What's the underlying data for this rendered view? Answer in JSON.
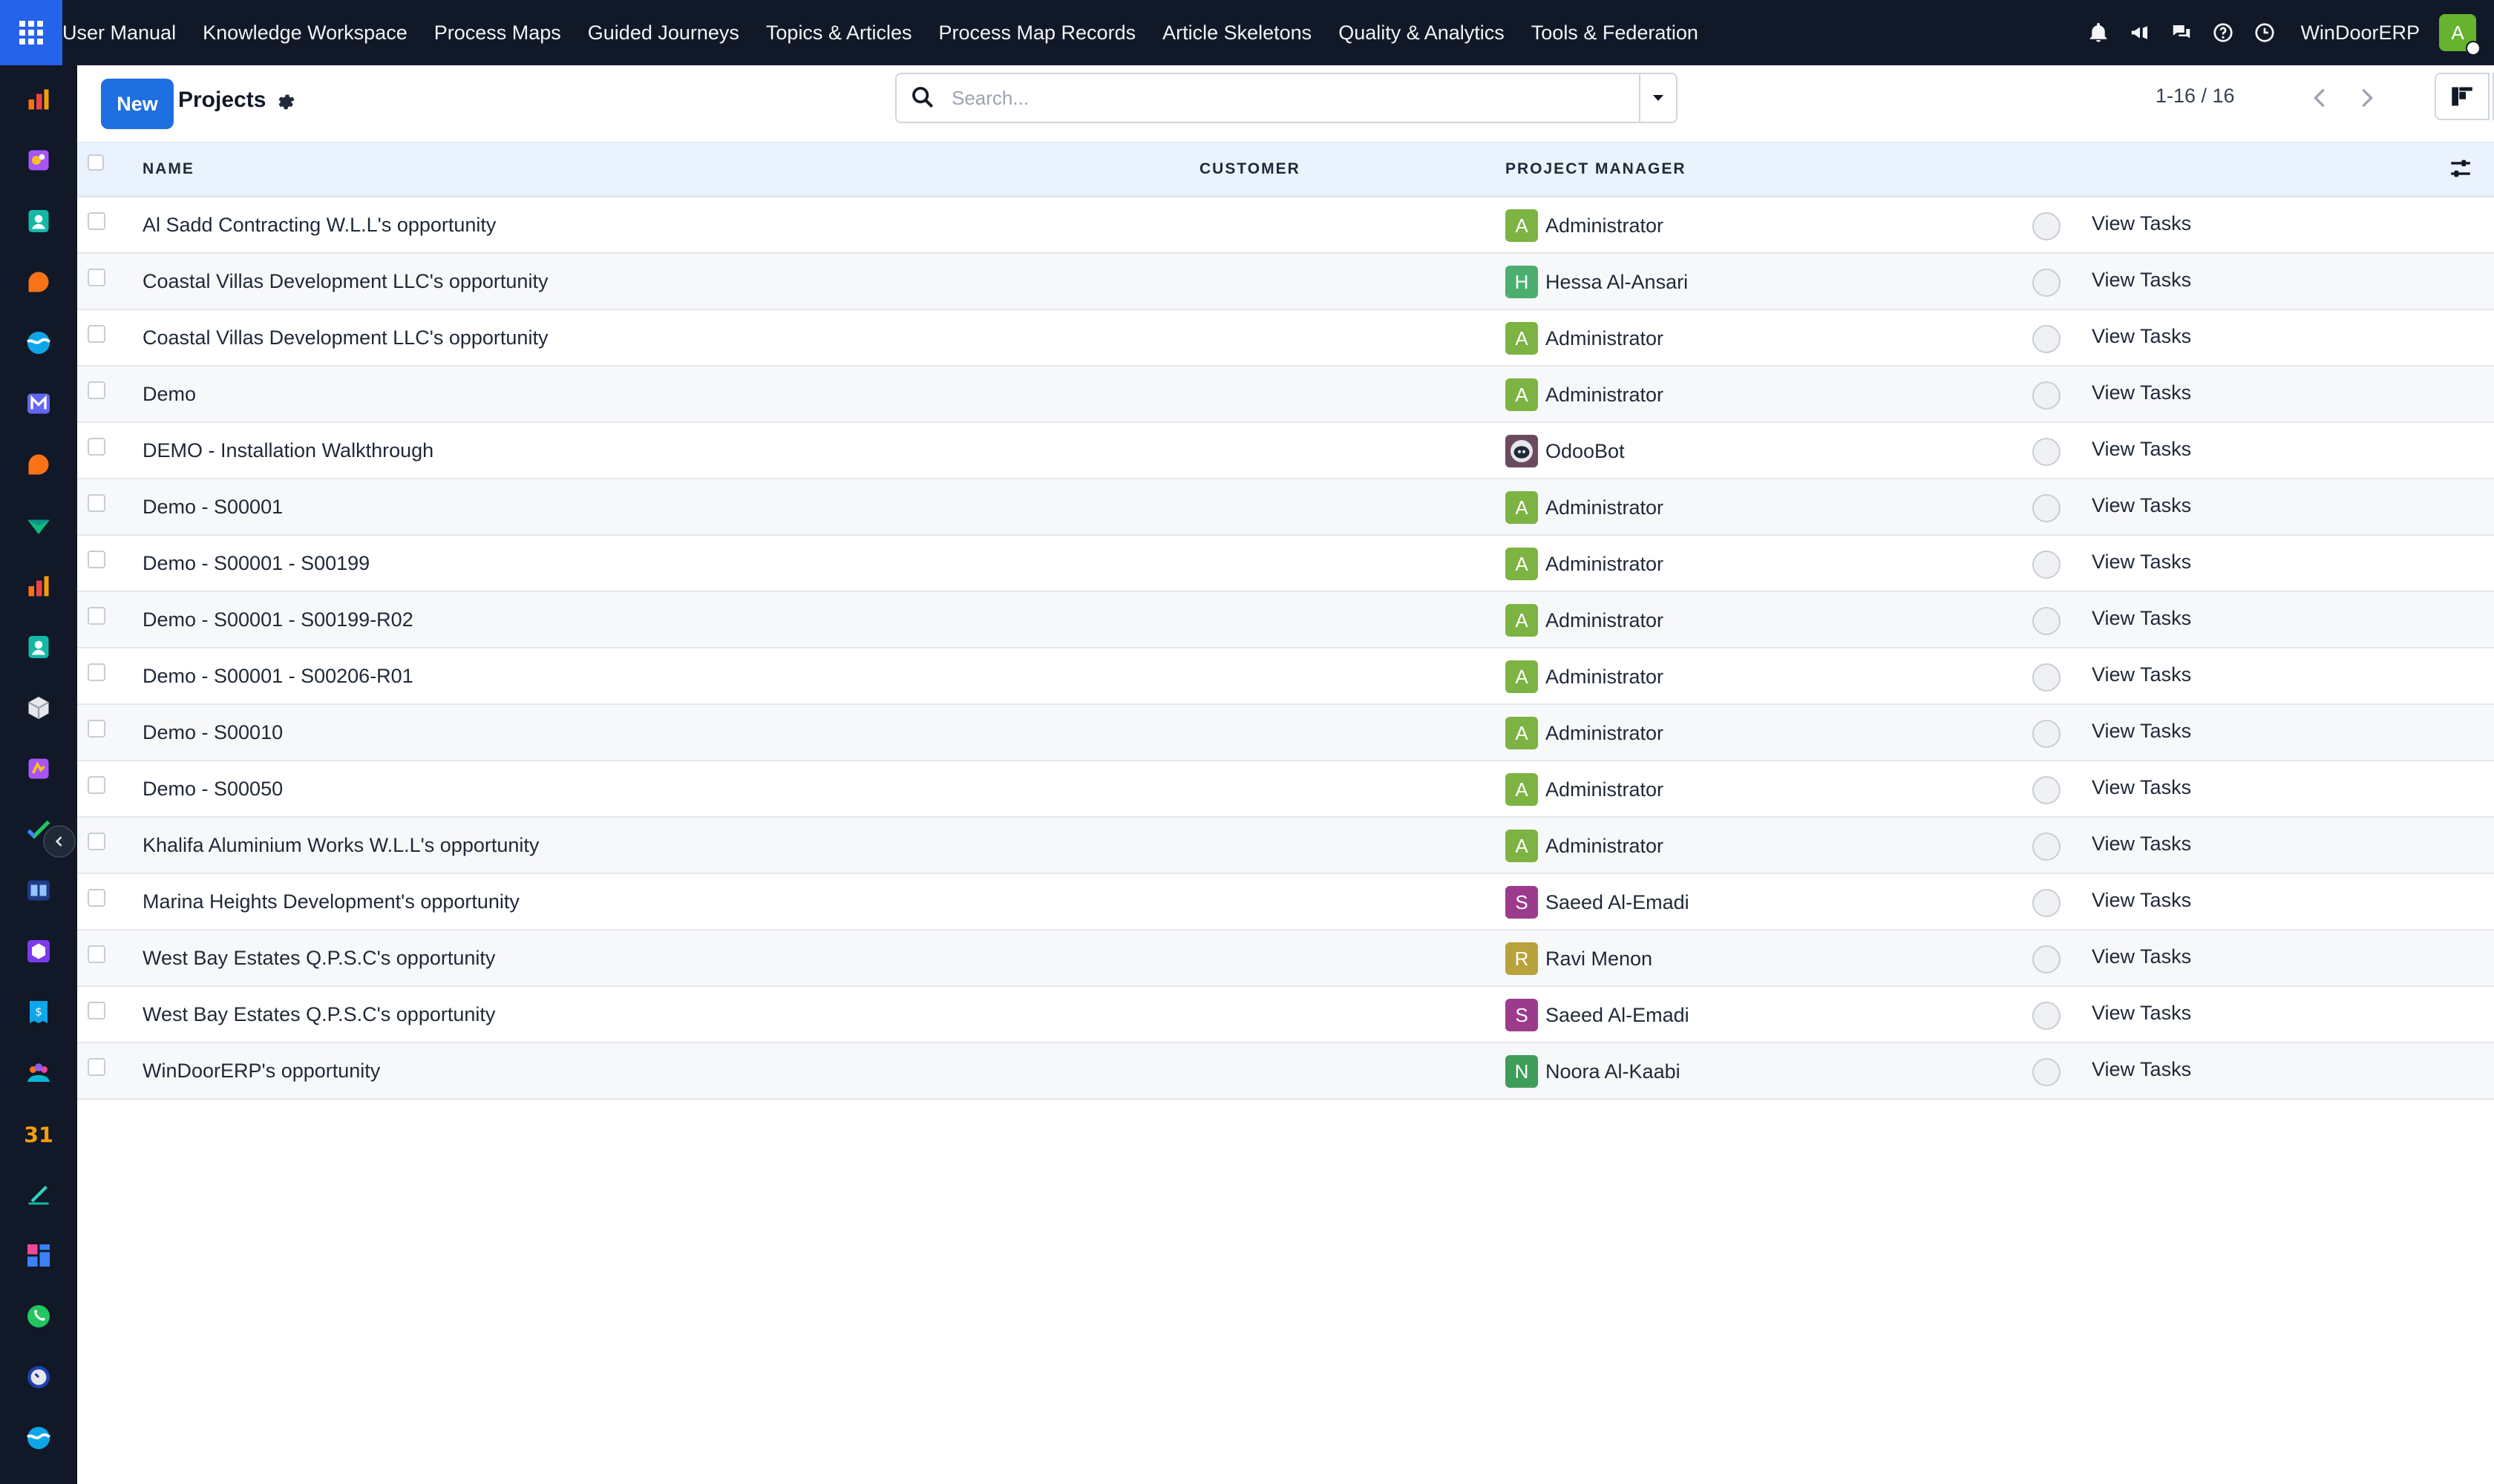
{
  "navbar": {
    "menu": [
      "User Manual",
      "Knowledge Workspace",
      "Process Maps",
      "Guided Journeys",
      "Topics & Articles",
      "Process Map Records",
      "Article Skeletons",
      "Quality & Analytics",
      "Tools & Federation"
    ],
    "company": "WinDoorERP",
    "user_initial": "A",
    "icons": [
      "bell-icon",
      "megaphone-icon",
      "chat-icon",
      "help-icon",
      "clock-icon"
    ]
  },
  "sidebar": {
    "apps": [
      "dashboard-app",
      "puzzle-app",
      "contacts-app",
      "discuss-app",
      "stream-app",
      "mail-app",
      "livechat-app",
      "marketing-app",
      "reports-app",
      "employees-app",
      "inventory-app",
      "quality-app",
      "project-app",
      "knowledge-app",
      "modules-app",
      "invoicing-app",
      "team-app",
      "calendar-app",
      "sign-app",
      "dashboards-app",
      "whatsapp-app",
      "clock-app",
      "wave-app"
    ]
  },
  "control": {
    "new_label": "New",
    "title": "Projects",
    "search_placeholder": "Search...",
    "pager": "1-16 / 16"
  },
  "table": {
    "columns": {
      "name": "NAME",
      "customer": "CUSTOMER",
      "manager": "PROJECT MANAGER"
    },
    "action_label": "View Tasks",
    "rows": [
      {
        "name": "Al Sadd Contracting W.L.L's opportunity",
        "manager": "Administrator",
        "initial": "A",
        "color": "#7cb342"
      },
      {
        "name": "Coastal Villas Development LLC's opportunity",
        "manager": "Hessa Al-Ansari",
        "initial": "H",
        "color": "#4caf6e"
      },
      {
        "name": "Coastal Villas Development LLC's opportunity",
        "manager": "Administrator",
        "initial": "A",
        "color": "#7cb342"
      },
      {
        "name": "Demo",
        "manager": "Administrator",
        "initial": "A",
        "color": "#7cb342"
      },
      {
        "name": "DEMO - Installation Walkthrough",
        "manager": "OdooBot",
        "initial": "",
        "color": "#6b4a5e"
      },
      {
        "name": "Demo - S00001",
        "manager": "Administrator",
        "initial": "A",
        "color": "#7cb342"
      },
      {
        "name": "Demo - S00001 - S00199",
        "manager": "Administrator",
        "initial": "A",
        "color": "#7cb342"
      },
      {
        "name": "Demo - S00001 - S00199-R02",
        "manager": "Administrator",
        "initial": "A",
        "color": "#7cb342"
      },
      {
        "name": "Demo - S00001 - S00206-R01",
        "manager": "Administrator",
        "initial": "A",
        "color": "#7cb342"
      },
      {
        "name": "Demo - S00010",
        "manager": "Administrator",
        "initial": "A",
        "color": "#7cb342"
      },
      {
        "name": "Demo - S00050",
        "manager": "Administrator",
        "initial": "A",
        "color": "#7cb342"
      },
      {
        "name": "Khalifa Aluminium Works W.L.L's opportunity",
        "manager": "Administrator",
        "initial": "A",
        "color": "#7cb342"
      },
      {
        "name": "Marina Heights Development's opportunity",
        "manager": "Saeed Al-Emadi",
        "initial": "S",
        "color": "#9c3b8c"
      },
      {
        "name": "West Bay Estates Q.P.S.C's opportunity",
        "manager": "Ravi Menon",
        "initial": "R",
        "color": "#b8a23c"
      },
      {
        "name": "West Bay Estates Q.P.S.C's opportunity",
        "manager": "Saeed Al-Emadi",
        "initial": "S",
        "color": "#9c3b8c"
      },
      {
        "name": "WinDoorERP's opportunity",
        "manager": "Noora Al-Kaabi",
        "initial": "N",
        "color": "#3f9d5a"
      }
    ]
  }
}
